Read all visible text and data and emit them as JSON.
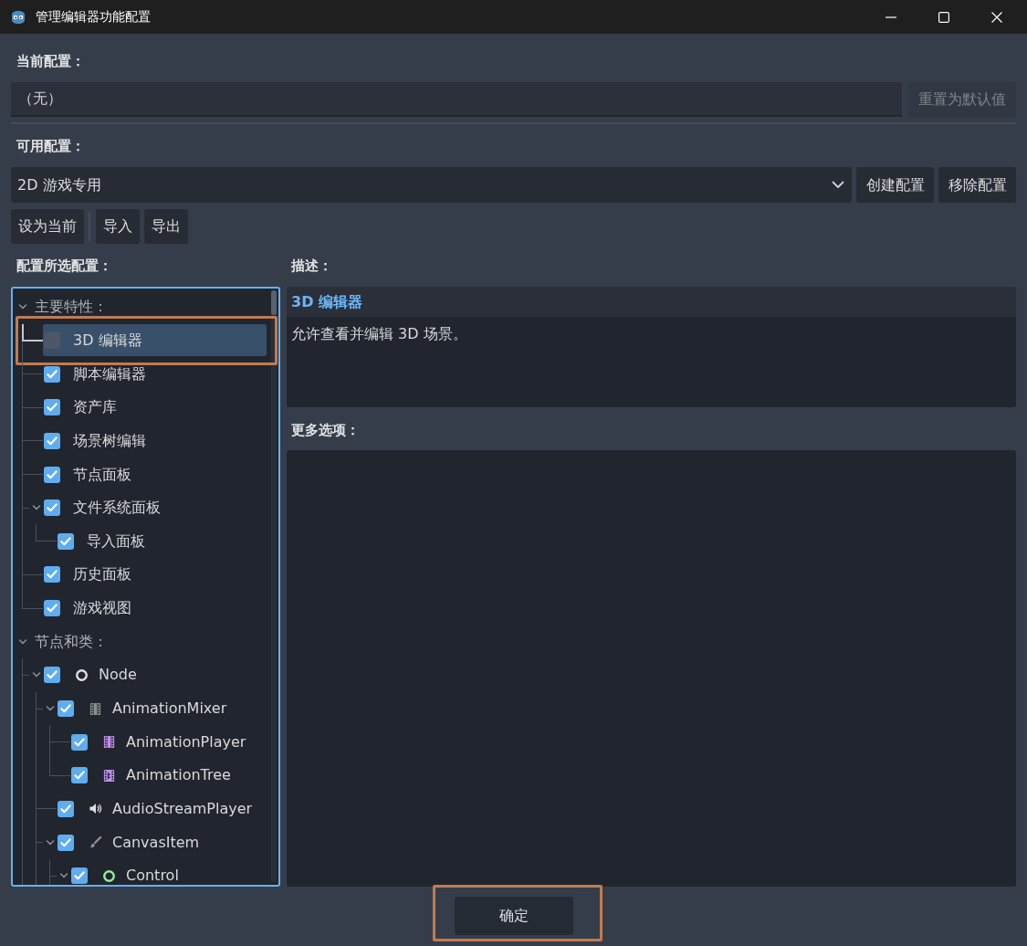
{
  "window": {
    "title": "管理编辑器功能配置"
  },
  "current_profile": {
    "label": "当前配置：",
    "value": "（无）",
    "reset_button": {
      "label": "重置为默认值",
      "disabled": true
    }
  },
  "available_profiles": {
    "label": "可用配置：",
    "selected_profile": "2D 游戏专用",
    "buttons": [
      {
        "label": "创建配置"
      },
      {
        "label": "移除配置"
      }
    ],
    "action_groups": [
      [
        {
          "label": "设为当前"
        }
      ],
      [
        {
          "label": "导入"
        },
        {
          "label": "导出"
        }
      ]
    ]
  },
  "profile_features": {
    "label": "配置所选配置：",
    "continues_below": true,
    "tree": [
      {
        "kind": "section",
        "label": "主要特性：",
        "selected": false,
        "expanded": true,
        "children": [
          {
            "kind": "feature",
            "label": "3D 编辑器",
            "checked": false,
            "selected": true,
            "highlighted": true
          },
          {
            "kind": "feature",
            "label": "脚本编辑器",
            "checked": true,
            "selected": false
          },
          {
            "kind": "feature",
            "label": "资产库",
            "checked": true,
            "selected": false
          },
          {
            "kind": "feature",
            "label": "场景树编辑",
            "checked": true,
            "selected": false
          },
          {
            "kind": "feature",
            "label": "节点面板",
            "checked": true,
            "selected": false
          },
          {
            "kind": "feature",
            "label": "文件系统面板",
            "checked": true,
            "selected": false,
            "expanded": true,
            "children": [
              {
                "kind": "feature",
                "label": "导入面板",
                "checked": true,
                "selected": false
              }
            ]
          },
          {
            "kind": "feature",
            "label": "历史面板",
            "checked": true,
            "selected": false
          },
          {
            "kind": "feature",
            "label": "游戏视图",
            "checked": true,
            "selected": false
          }
        ]
      },
      {
        "kind": "section",
        "label": "节点和类：",
        "selected": false,
        "expanded": true,
        "children": [
          {
            "kind": "ring",
            "label": "Node",
            "color": "#e0e0e0",
            "checked": true,
            "selected": false,
            "expanded": true,
            "children": [
              {
                "kind": "film",
                "label": "AnimationMixer",
                "color": "#8f8f8f",
                "checked": true,
                "selected": false,
                "expanded": true,
                "children": [
                  {
                    "kind": "film",
                    "label": "AnimationPlayer",
                    "color": "#c38ef1",
                    "checked": true,
                    "selected": false
                  },
                  {
                    "kind": "filmtree",
                    "label": "AnimationTree",
                    "color": "#c38ef1",
                    "checked": true,
                    "selected": false
                  }
                ]
              },
              {
                "kind": "speaker",
                "label": "AudioStreamPlayer",
                "color": "#e0e0e0",
                "checked": true,
                "selected": false
              },
              {
                "kind": "brush",
                "label": "CanvasItem",
                "color": "#8f8f8f",
                "checked": true,
                "selected": false,
                "expanded": true,
                "children": [
                  {
                    "kind": "ring",
                    "label": "Control",
                    "color": "#8eef97",
                    "checked": true,
                    "selected": false,
                    "expanded": true
                  }
                ]
              }
            ]
          }
        ]
      }
    ]
  },
  "description": {
    "label": "描述：",
    "title": "3D 编辑器",
    "text": "允许查看并编辑 3D 场景。"
  },
  "more_options": {
    "label": "更多选项："
  },
  "footer": {
    "ok_button": {
      "label": "确定",
      "highlighted": true
    }
  }
}
